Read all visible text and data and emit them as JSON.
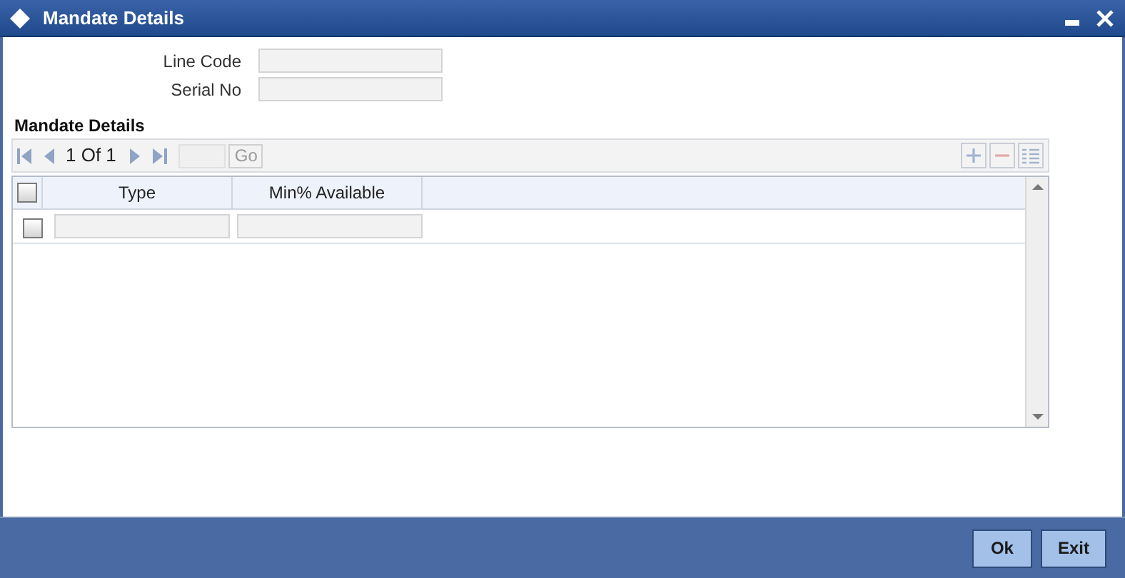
{
  "window": {
    "title": "Mandate Details"
  },
  "fields": [
    {
      "label": "Line Code"
    },
    {
      "label": "Serial No"
    }
  ],
  "section": {
    "title": "Mandate Details"
  },
  "pager": {
    "text": "1 Of 1",
    "go": "Go"
  },
  "table": {
    "select_all": {
      "checked": false
    },
    "columns": [
      "Type",
      "Min% Available"
    ],
    "rows": [
      {
        "checked": false
      }
    ]
  },
  "buttons": [
    "Ok",
    "Exit"
  ]
}
